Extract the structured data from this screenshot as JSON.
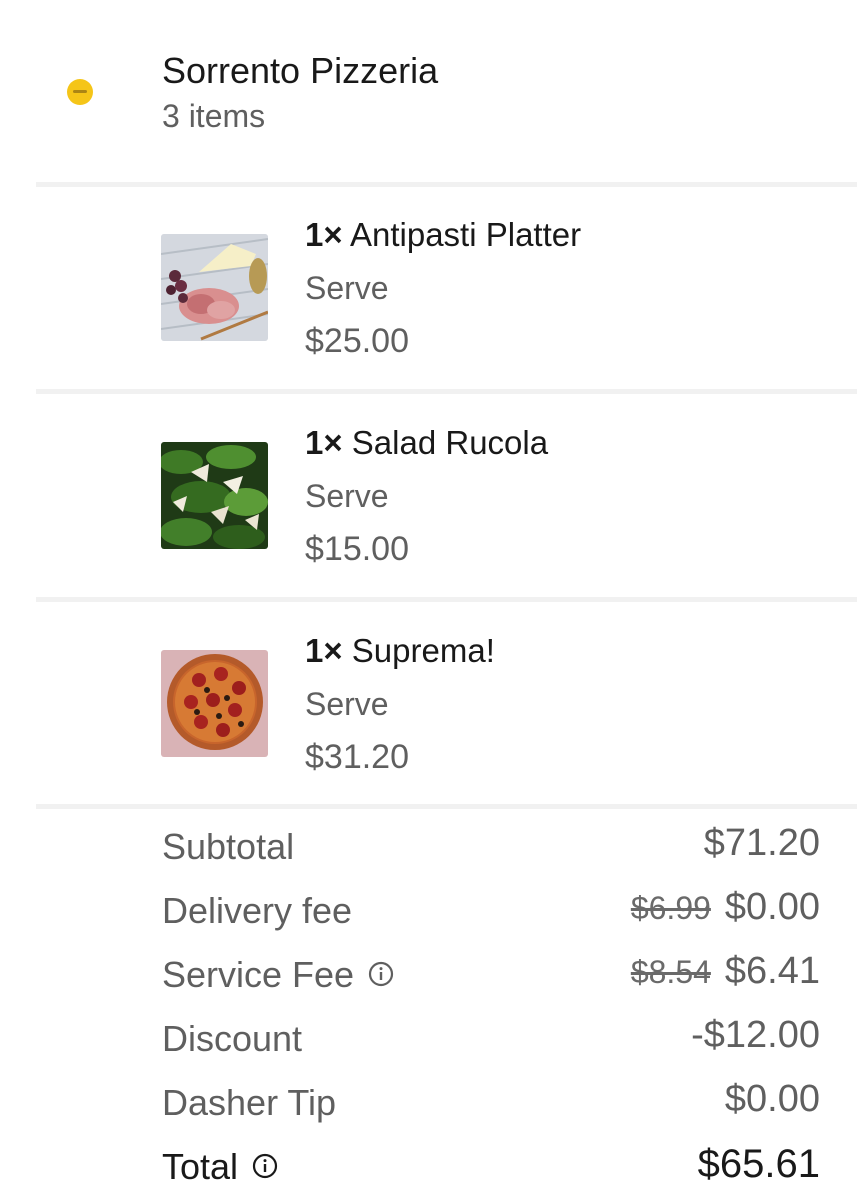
{
  "store": {
    "name": "Sorrento Pizzeria",
    "item_count": "3 items",
    "logo_color": "#f5c518"
  },
  "items": [
    {
      "qty": "1×",
      "name": "Antipasti Platter",
      "option": "Serve",
      "price": "$25.00",
      "image": "antipasti-platter-photo"
    },
    {
      "qty": "1×",
      "name": "Salad Rucola",
      "option": "Serve",
      "price": "$15.00",
      "image": "rucola-salad-photo"
    },
    {
      "qty": "1×",
      "name": "Suprema!",
      "option": "Serve",
      "price": "$31.20",
      "image": "pepperoni-pizza-photo"
    }
  ],
  "summary": {
    "subtotal": {
      "label": "Subtotal",
      "value": "$71.20"
    },
    "delivery_fee": {
      "label": "Delivery fee",
      "original": "$6.99",
      "value": "$0.00"
    },
    "service_fee": {
      "label": "Service Fee",
      "original": "$8.54",
      "value": "$6.41",
      "icon": "info-icon"
    },
    "discount": {
      "label": "Discount",
      "value": "-$12.00"
    },
    "dasher_tip": {
      "label": "Dasher Tip",
      "value": "$0.00"
    },
    "total": {
      "label": "Total",
      "value": "$65.61",
      "icon": "info-icon"
    }
  },
  "colors": {
    "primary_text": "#191919",
    "secondary_text": "#5f5f5f",
    "divider": "#f1f1f1"
  }
}
